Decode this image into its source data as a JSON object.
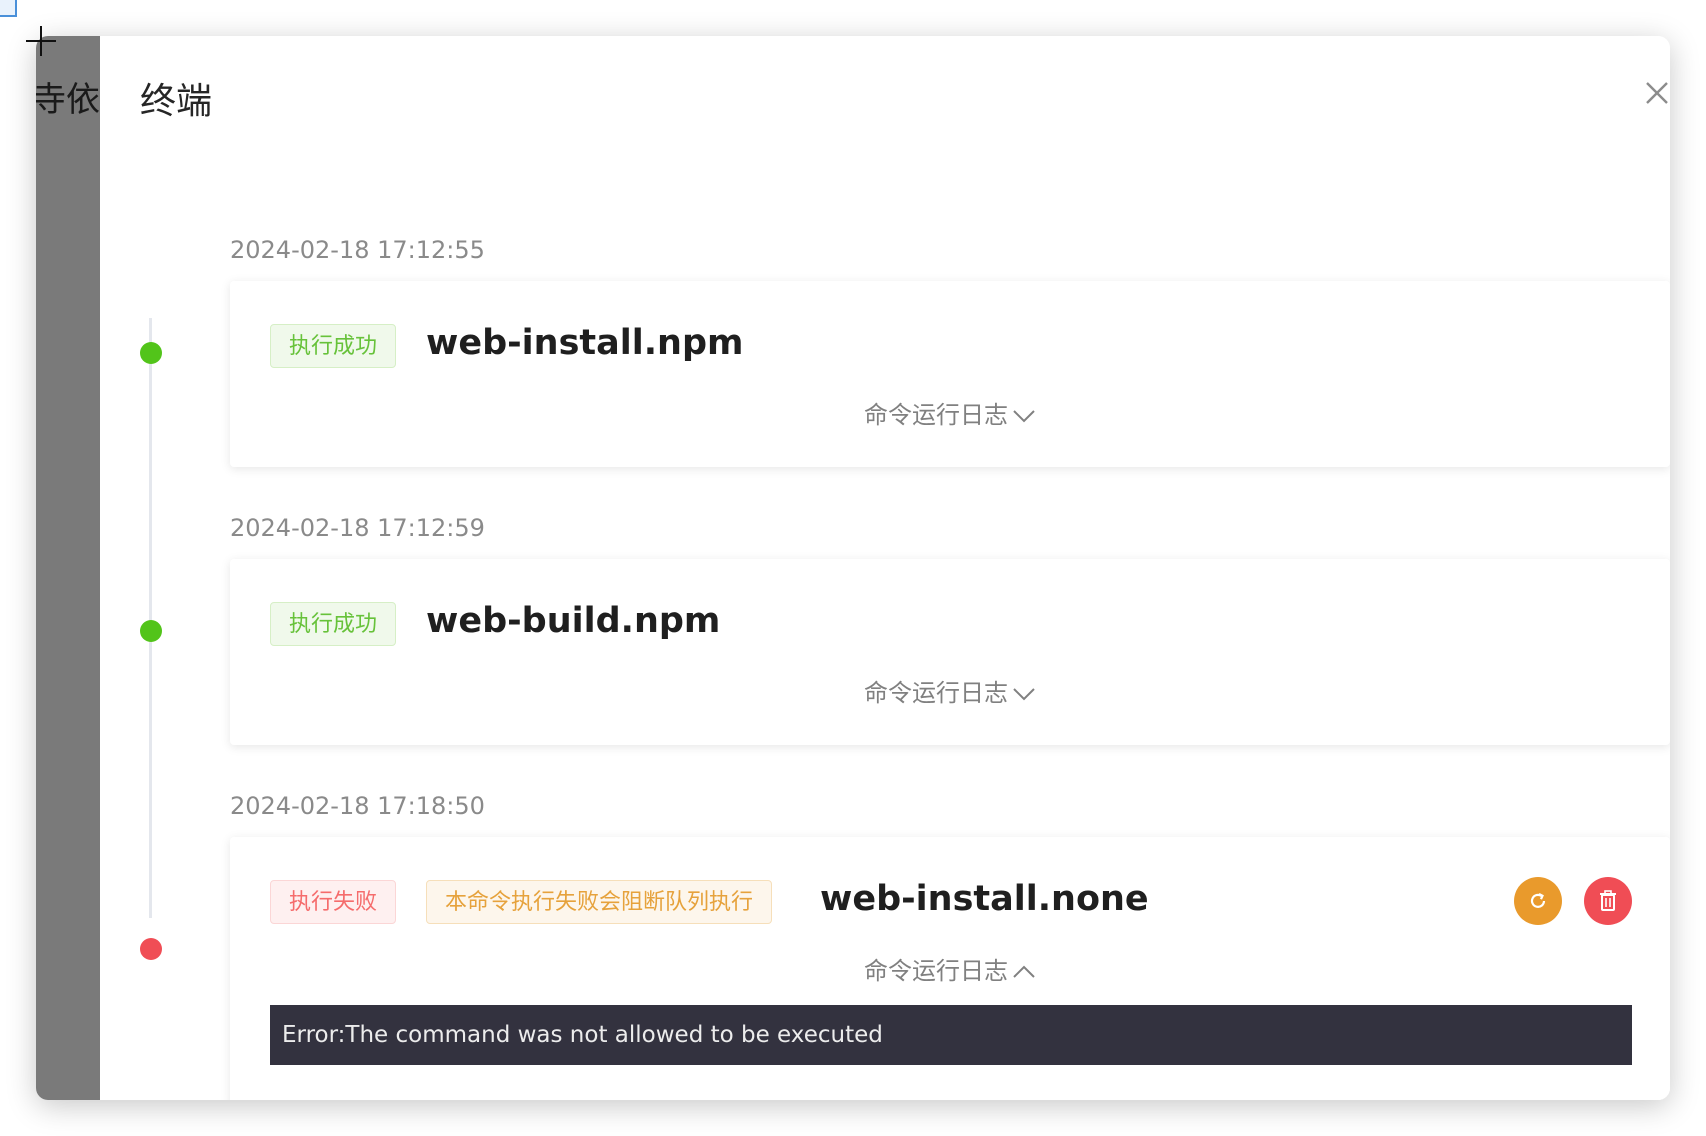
{
  "backdrop": {
    "partial_text": "寺依赖"
  },
  "drawer": {
    "title": "终端"
  },
  "tasks": [
    {
      "timestamp": "2024-02-18 17:12:55",
      "status_tag": "执行成功",
      "command": "web-install.npm",
      "log_toggle": "命令运行日志",
      "expanded": false
    },
    {
      "timestamp": "2024-02-18 17:12:59",
      "status_tag": "执行成功",
      "command": "web-build.npm",
      "log_toggle": "命令运行日志",
      "expanded": false
    },
    {
      "timestamp": "2024-02-18 17:18:50",
      "status_tag": "执行失败",
      "warning_tag": "本命令执行失败会阻断队列执行",
      "command": "web-install.none",
      "log_toggle": "命令运行日志",
      "expanded": true,
      "log_output": "Error:The command was not allowed to be executed"
    }
  ],
  "colors": {
    "success": "#52c41a",
    "danger": "#f04d55",
    "warning": "#e99a2c",
    "log_bg": "#33323f"
  },
  "icons": [
    "close-icon",
    "chevron-down-icon",
    "chevron-up-icon",
    "retry-icon",
    "trash-icon"
  ]
}
